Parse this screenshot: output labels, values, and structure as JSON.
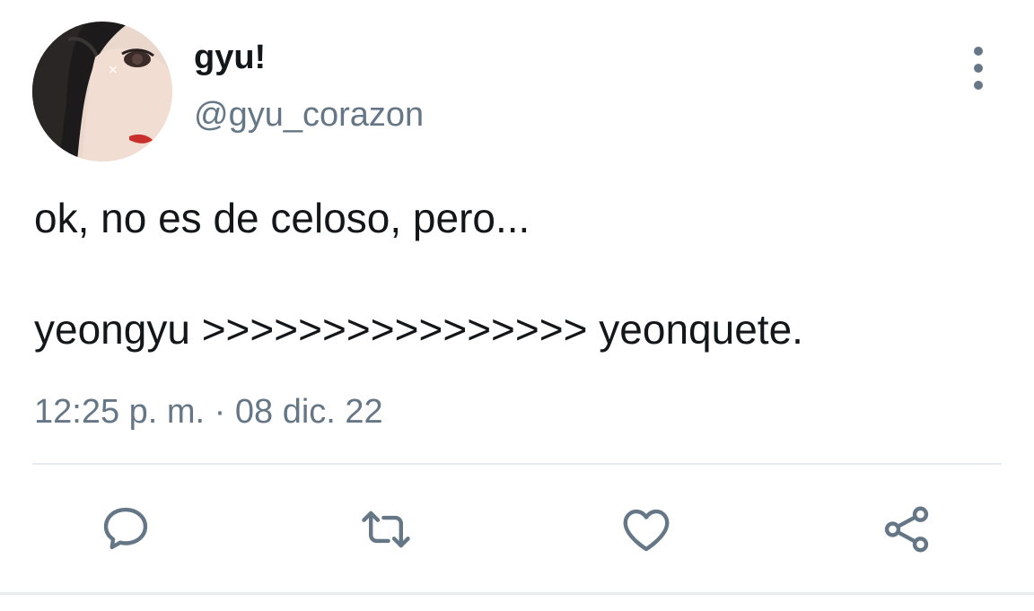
{
  "tweet": {
    "author": {
      "display_name": "gyu!",
      "handle": "@gyu_corazon",
      "avatar_icon": "profile-photo"
    },
    "text_lines": [
      "ok, no es de celoso, pero...",
      "yeongyu >>>>>>>>>>>>>>>> yeonquete."
    ],
    "timestamp": "12:25 p. m. · 08 dic. 22",
    "actions": [
      {
        "name": "reply",
        "icon": "comment-bubble-icon"
      },
      {
        "name": "retweet",
        "icon": "retweet-arrows-icon"
      },
      {
        "name": "like",
        "icon": "heart-icon"
      },
      {
        "name": "share",
        "icon": "share-nodes-icon"
      }
    ],
    "more_icon": "vertical-dots-icon"
  },
  "colors": {
    "text_primary": "#14171a",
    "text_secondary": "#657786",
    "divider": "#e6ecf0",
    "background": "#ffffff"
  }
}
